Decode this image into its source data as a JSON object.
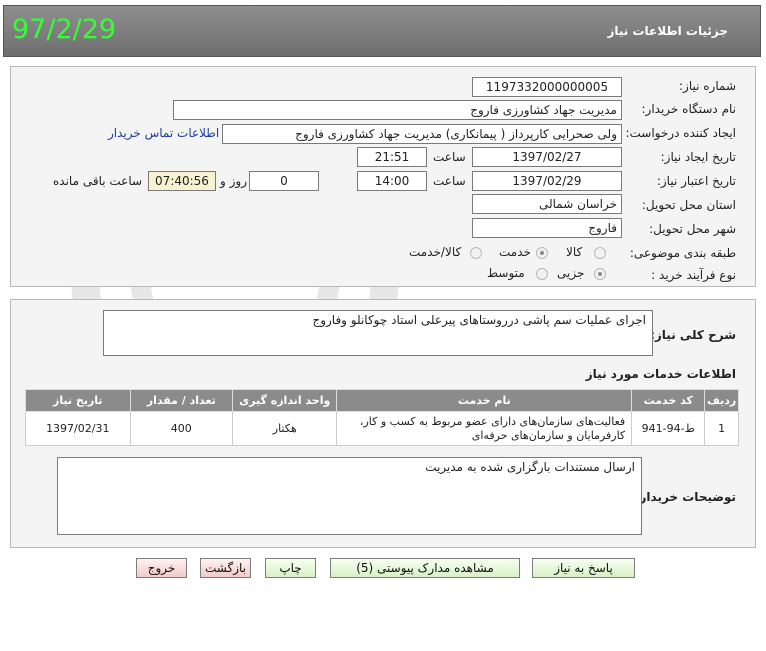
{
  "header": {
    "title": "جزئیات اطلاعات نیاز",
    "date": "97/2/29"
  },
  "form": {
    "need_number_label": "شماره نیاز:",
    "need_number": "1197332000000005",
    "buyer_org_label": "نام دستگاه خریدار:",
    "buyer_org": "مدیریت جهاد کشاورزی فاروج",
    "requester_label": "ایجاد کننده درخواست:",
    "requester": "ولی صحرایی کارپرداز ( پیمانکاری) مدیریت جهاد کشاورزی فاروج",
    "contact_link": "اطلاعات تماس خریدار",
    "created_label": "تاریخ ایجاد نیاز:",
    "created_date": "1397/02/27",
    "time_label": "ساعت",
    "created_time": "21:51",
    "validity_label": "تاریخ اعتبار نیاز:",
    "validity_date": "1397/02/29",
    "validity_time": "14:00",
    "days_label": "روز و",
    "days_value": "0",
    "remaining_time": "07:40:56",
    "remaining_label": "ساعت باقی مانده",
    "province_label": "استان محل تحویل:",
    "province": "خراسان شمالی",
    "city_label": "شهر محل تحویل:",
    "city": "فاروج",
    "category_label": "طبقه بندی موضوعی:",
    "category_options": [
      "کالا",
      "خدمت",
      "کالا/خدمت"
    ],
    "category_selected": "خدمت",
    "process_label": "نوع فرآیند خرید :",
    "process_options": [
      "جزیی",
      "متوسط"
    ],
    "process_selected": "جزیی"
  },
  "description": {
    "label": "شرح کلی نیاز:",
    "text": "اجرای عملیات سم پاشی درروستاهای پیرعلی استاد چوکانلو وفاروج"
  },
  "services": {
    "title": "اطلاعات خدمات مورد نیاز",
    "columns": [
      "ردیف",
      "کد خدمت",
      "نام خدمت",
      "واحد اندازه گیری",
      "تعداد / مقدار",
      "تاریخ نیاز"
    ],
    "rows": [
      {
        "index": "1",
        "code": "ط-94-941",
        "name": "فعالیت‌های سازمان‌های دارای عضو مربوط به کسب و کار، کارفرمایان و سازمان‌های حرفه‌ای",
        "unit": "هکتار",
        "quantity": "400",
        "date": "1397/02/31"
      }
    ]
  },
  "buyer_notes": {
    "label": "توضیحات خریدار:",
    "text": "ارسال مستندات بارگزاری شده به مدیریت"
  },
  "buttons": {
    "reply": "پاسخ به نیاز",
    "attachments": "مشاهده مدارک پیوستی (5)",
    "print": "چاپ",
    "back": "بازگشت",
    "exit": "خروج"
  },
  "colors": {
    "header_bg": "#7d7d7d",
    "date_green": "#33ff33",
    "link": "#1a3fa0",
    "button_green": "#d8f0c6",
    "button_pink": "#f4c9c9"
  }
}
